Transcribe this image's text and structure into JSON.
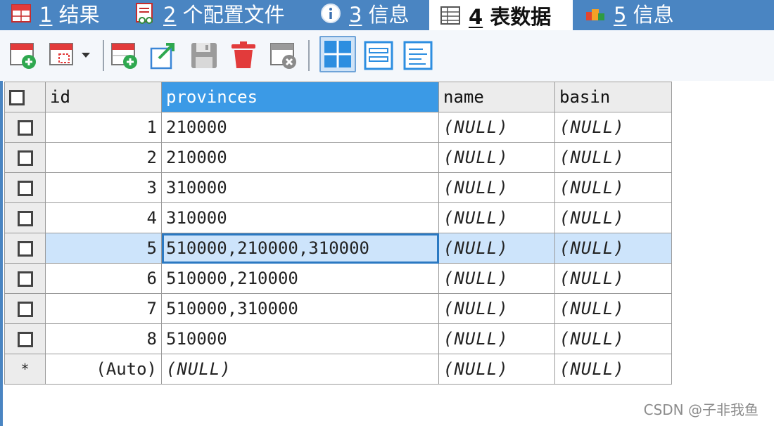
{
  "tabs": [
    {
      "num": "1",
      "label": "结果",
      "icon": "result-grid-icon",
      "active": false
    },
    {
      "num": "2",
      "label": "个配置文件",
      "icon": "profile-icon",
      "active": false
    },
    {
      "num": "3",
      "label": "信息",
      "icon": "info-icon",
      "active": false
    },
    {
      "num": "4",
      "label": "表数据",
      "icon": "table-data-icon",
      "active": true
    },
    {
      "num": "5",
      "label": "信息",
      "icon": "info-blocks-icon",
      "active": false
    }
  ],
  "toolbar": {
    "buttons": [
      "add-row-icon",
      "duplicate-row-icon",
      "insert-row-icon",
      "export-icon",
      "save-icon",
      "delete-icon",
      "cancel-changes-icon",
      "grid-view-icon",
      "form-view-icon",
      "text-view-icon"
    ],
    "active_view": "grid-view-icon"
  },
  "grid": {
    "columns": [
      "id",
      "provinces",
      "name",
      "basin"
    ],
    "selected_column": "provinces",
    "selected_row": 5,
    "rows": [
      {
        "id": "1",
        "provinces": "210000",
        "name": "(NULL)",
        "basin": "(NULL)"
      },
      {
        "id": "2",
        "provinces": "210000",
        "name": "(NULL)",
        "basin": "(NULL)"
      },
      {
        "id": "3",
        "provinces": "310000",
        "name": "(NULL)",
        "basin": "(NULL)"
      },
      {
        "id": "4",
        "provinces": "310000",
        "name": "(NULL)",
        "basin": "(NULL)"
      },
      {
        "id": "5",
        "provinces": "510000,210000,310000",
        "name": "(NULL)",
        "basin": "(NULL)"
      },
      {
        "id": "6",
        "provinces": "510000,210000",
        "name": "(NULL)",
        "basin": "(NULL)"
      },
      {
        "id": "7",
        "provinces": "510000,310000",
        "name": "(NULL)",
        "basin": "(NULL)"
      },
      {
        "id": "8",
        "provinces": "510000",
        "name": "(NULL)",
        "basin": "(NULL)"
      }
    ],
    "new_row": {
      "marker": "*",
      "id": "(Auto)",
      "provinces": "(NULL)",
      "name": "(NULL)",
      "basin": "(NULL)"
    }
  },
  "watermark": "CSDN @子非我鱼",
  "colors": {
    "tabbar": "#4a85c2",
    "selected_header": "#3b9ae6",
    "selected_row": "#cde4fb",
    "focus_border": "#2b79c2"
  }
}
